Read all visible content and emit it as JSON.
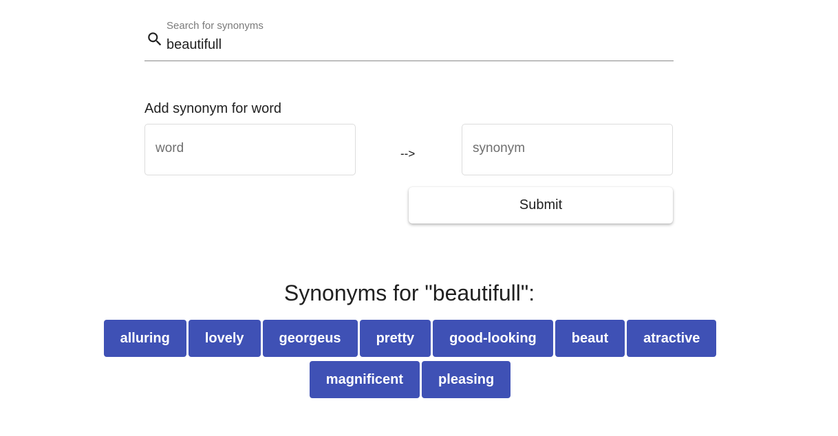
{
  "search": {
    "label": "Search for synonyms",
    "value": "beautifull",
    "icon": "search-icon"
  },
  "add_synonym": {
    "title": "Add synonym for word",
    "word_placeholder": "word",
    "synonym_placeholder": "synonym",
    "arrow": "-->",
    "submit_label": "Submit"
  },
  "results": {
    "title": "Synonyms for \"beautifull\":",
    "chip_color": "#3f51b5",
    "synonyms": [
      "alluring",
      "lovely",
      "georgeus",
      "pretty",
      "good-looking",
      "beaut",
      "atractive",
      "magnificent",
      "pleasing"
    ]
  }
}
